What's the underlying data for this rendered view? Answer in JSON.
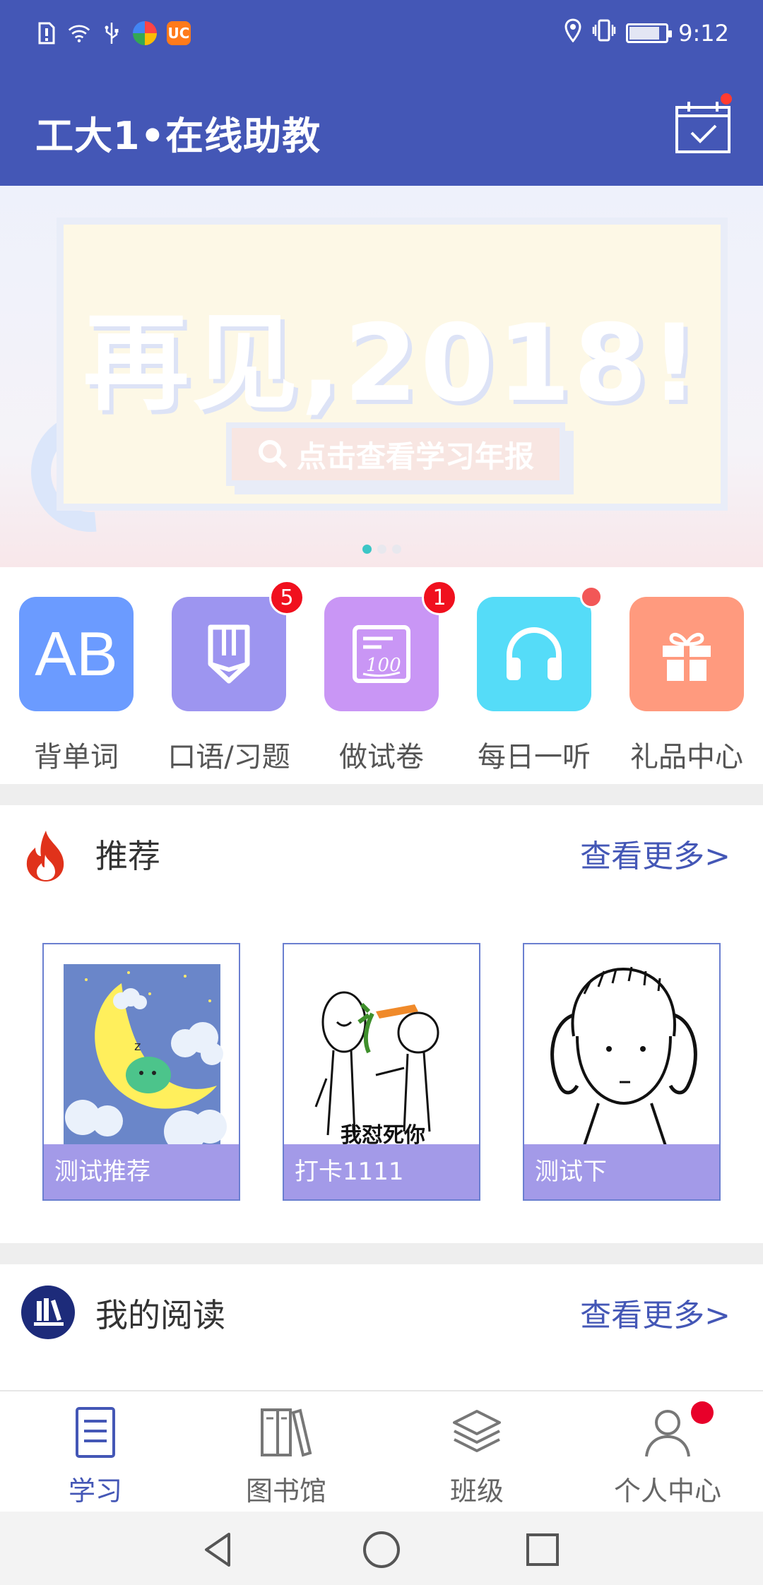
{
  "status_bar": {
    "time": "9:12",
    "icons": [
      "alert-icon",
      "wifi-icon",
      "usb-icon",
      "browser-app-icon",
      "uc-app-icon",
      "location-icon",
      "vibrate-icon",
      "battery-icon"
    ],
    "battery_level": 0.85
  },
  "header": {
    "title": "工大1•在线助教",
    "checkin_icon": "calendar-check-icon"
  },
  "banner": {
    "headline": "再见,2018!",
    "button_text": "点击查看学习年报",
    "page_count": 3,
    "active_page": 0
  },
  "shortcuts": [
    {
      "label": "背单词",
      "icon": "ab-icon",
      "color": "#6b9bff",
      "glyph": "AB",
      "badge": ""
    },
    {
      "label": "口语/习题",
      "icon": "pencil-icon",
      "color": "#9d95f0",
      "badge": "5"
    },
    {
      "label": "做试卷",
      "icon": "exam-paper-icon",
      "color": "#c996f5",
      "badge": "1"
    },
    {
      "label": "每日一听",
      "icon": "headphones-icon",
      "color": "#55dcf8",
      "badge": "dot"
    },
    {
      "label": "礼品中心",
      "icon": "gift-icon",
      "color": "#ff9a7e",
      "badge": ""
    }
  ],
  "recommend": {
    "title": "推荐",
    "more": "查看更多>",
    "items": [
      {
        "label": "测试推荐"
      },
      {
        "label": "打卡1111",
        "caption": "我怼死你"
      },
      {
        "label": "测试下"
      }
    ]
  },
  "reading": {
    "title": "我的阅读",
    "more": "查看更多>"
  },
  "bottom_nav": [
    {
      "label": "学习",
      "icon": "study-list-icon",
      "active": true
    },
    {
      "label": "图书馆",
      "icon": "library-books-icon",
      "active": false
    },
    {
      "label": "班级",
      "icon": "layers-icon",
      "active": false
    },
    {
      "label": "个人中心",
      "icon": "person-icon",
      "active": false
    }
  ],
  "colors": {
    "primary": "#4457b6",
    "badge": "#f0101e",
    "card_label_bg": "#a39ae8"
  }
}
